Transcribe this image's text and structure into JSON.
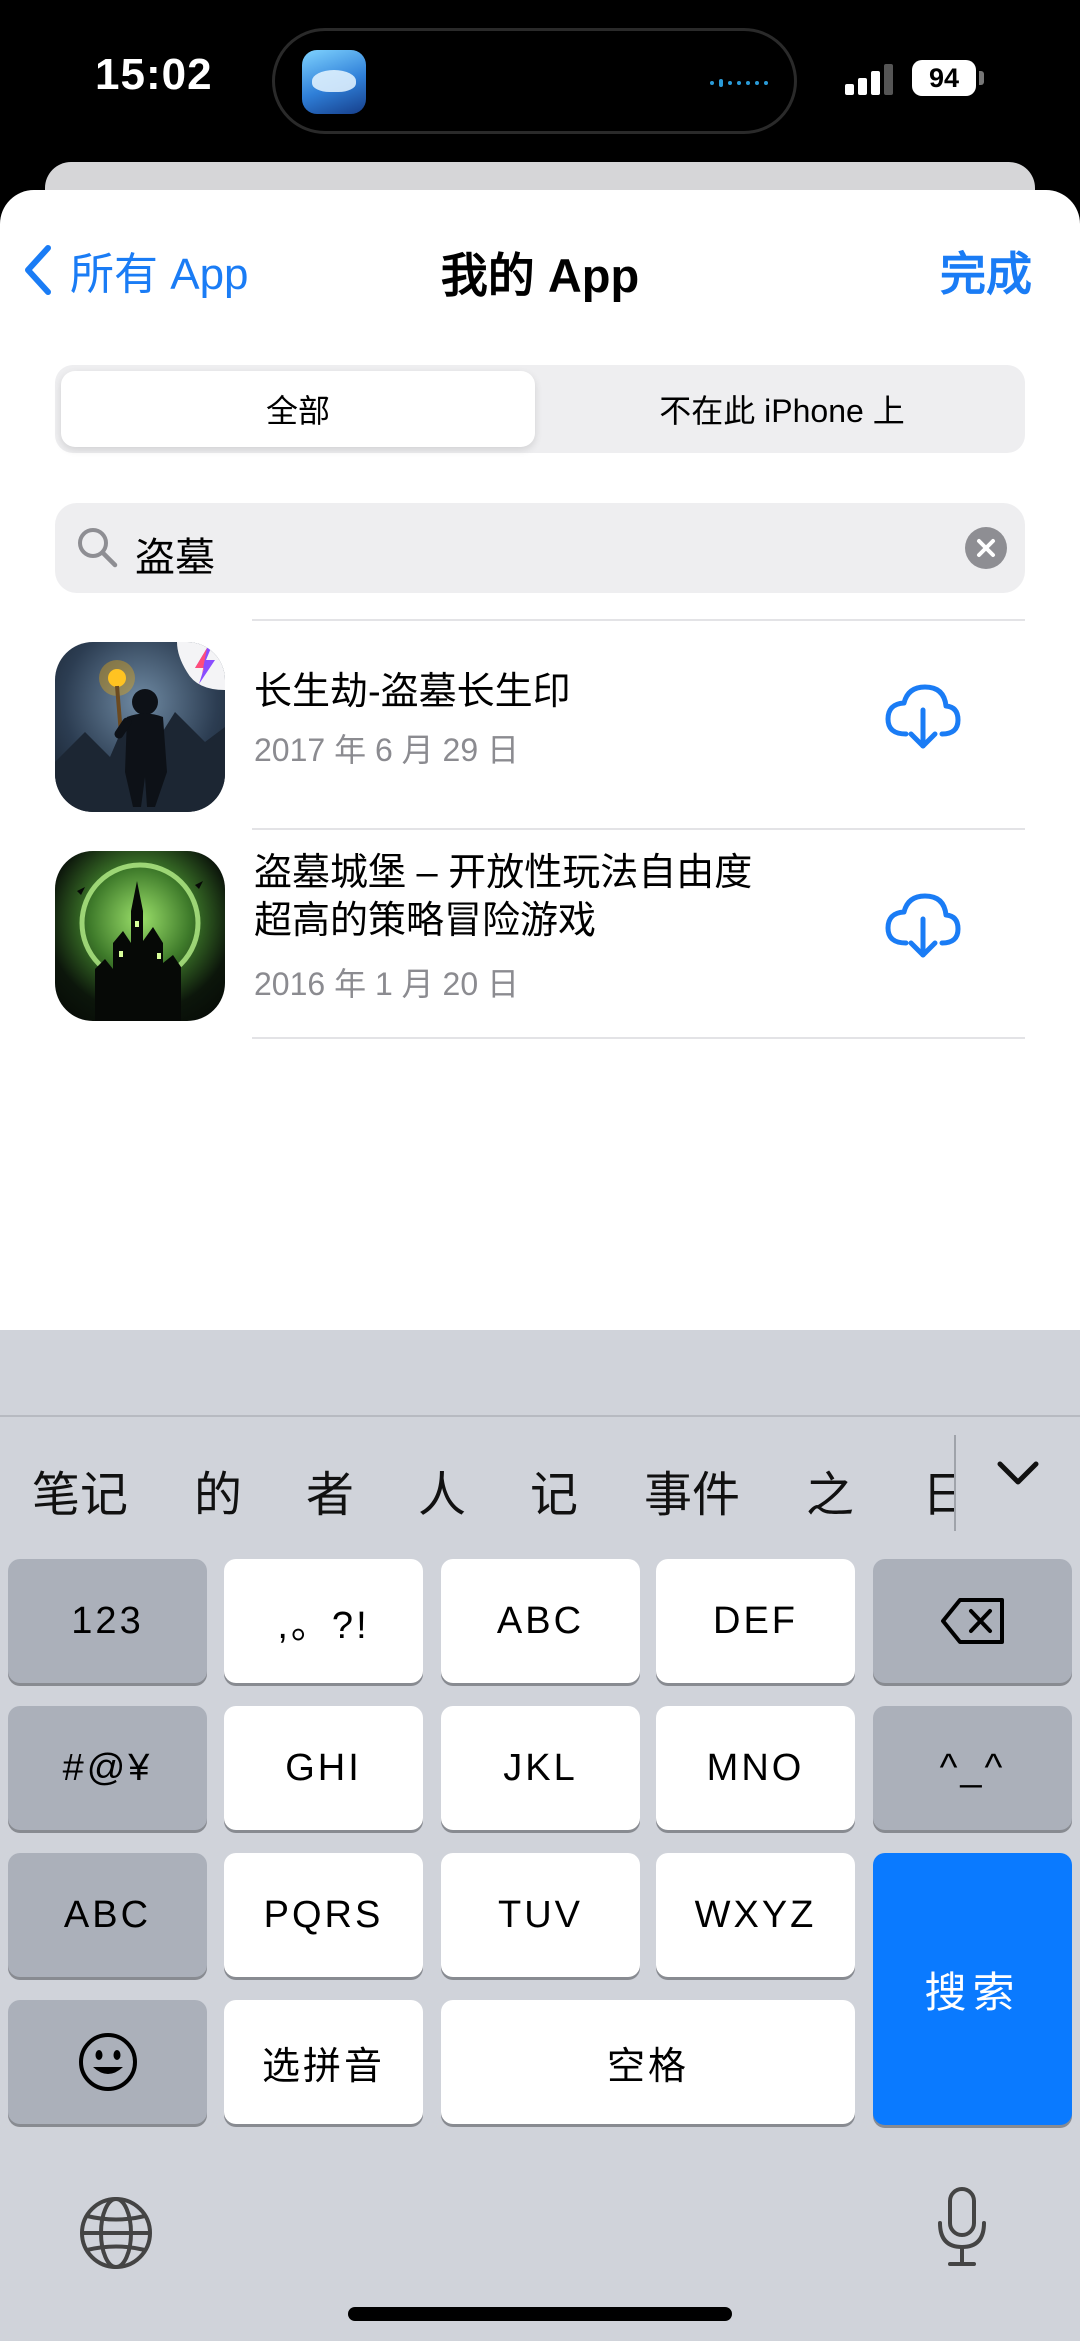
{
  "status_bar": {
    "time": "15:02",
    "battery": "94",
    "island_app_icon": "blue-cloud-game-icon"
  },
  "nav": {
    "back_label": "所有 App",
    "title": "我的 App",
    "done_label": "完成"
  },
  "segmented": {
    "selected": "全部",
    "other": "不在此 iPhone 上"
  },
  "search": {
    "value": "盗墓"
  },
  "apps": [
    {
      "title_lines": [
        "长生劫-盗墓长生印"
      ],
      "date": "2017 年 6 月 29 日",
      "icon": "explorer-torch-icon",
      "badge_icon": "lightning-badge-icon"
    },
    {
      "title_lines": [
        "盗墓城堡 – 开放性玩法自由度",
        "超高的策略冒险游戏"
      ],
      "date": "2016 年 1 月 20 日",
      "icon": "castle-moon-icon"
    }
  ],
  "keyboard": {
    "candidates": [
      "笔记",
      "的",
      "者",
      "人",
      "记",
      "事件",
      "之",
      "日"
    ],
    "row1": [
      "123",
      ",。?!",
      "ABC",
      "DEF"
    ],
    "row2": [
      "#@¥",
      "GHI",
      "JKL",
      "MNO",
      "^_^"
    ],
    "row3": [
      "ABC",
      "PQRS",
      "TUV",
      "WXYZ"
    ],
    "row4": [
      "选拼音",
      "空格"
    ],
    "search_key": "搜索"
  },
  "colors": {
    "accent": "#1a7cf5",
    "search_key": "#0a7aff",
    "keyboard_bg": "#d0d3da"
  }
}
